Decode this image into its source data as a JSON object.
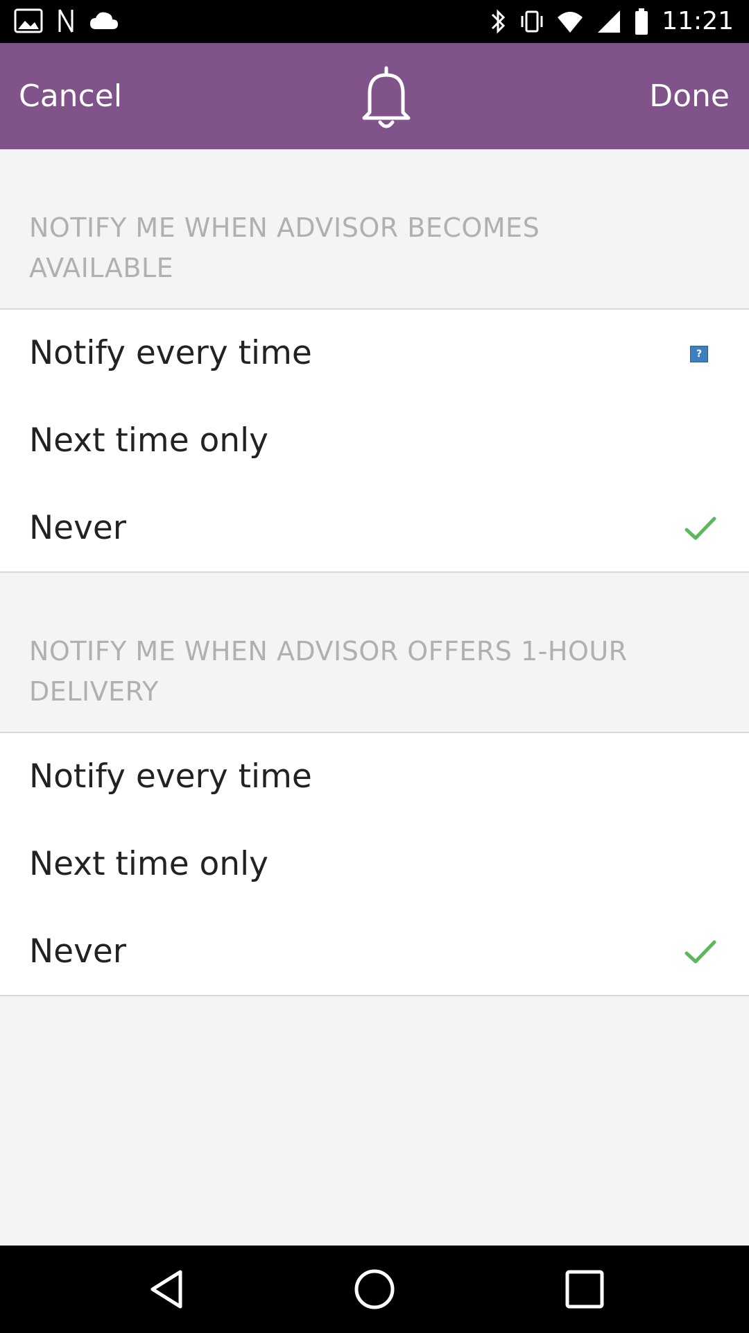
{
  "status_bar": {
    "time": "11:21",
    "left_icons": [
      "gallery-icon",
      "nfc-icon",
      "cloud-icon"
    ],
    "right_icons": [
      "bluetooth-icon",
      "vibrate-icon",
      "wifi-icon",
      "signal-icon",
      "battery-icon"
    ]
  },
  "header": {
    "cancel_label": "Cancel",
    "done_label": "Done",
    "center_icon": "bell-icon",
    "background_color": "#80538a"
  },
  "sections": [
    {
      "title": "NOTIFY ME WHEN ADVISOR BECOMES AVAILABLE",
      "options": [
        {
          "label": "Notify every time",
          "selected": false,
          "indicator": "help-icon"
        },
        {
          "label": "Next time only",
          "selected": false
        },
        {
          "label": "Never",
          "selected": true
        }
      ]
    },
    {
      "title": "NOTIFY ME WHEN ADVISOR OFFERS 1-HOUR DELIVERY",
      "options": [
        {
          "label": "Notify every time",
          "selected": false
        },
        {
          "label": "Next time only",
          "selected": false
        },
        {
          "label": "Never",
          "selected": true
        }
      ]
    }
  ],
  "colors": {
    "check": "#5cb85c",
    "section_title": "#b0b0b0"
  },
  "nav_bar": {
    "buttons": [
      "back-icon",
      "home-icon",
      "recent-apps-icon"
    ]
  }
}
